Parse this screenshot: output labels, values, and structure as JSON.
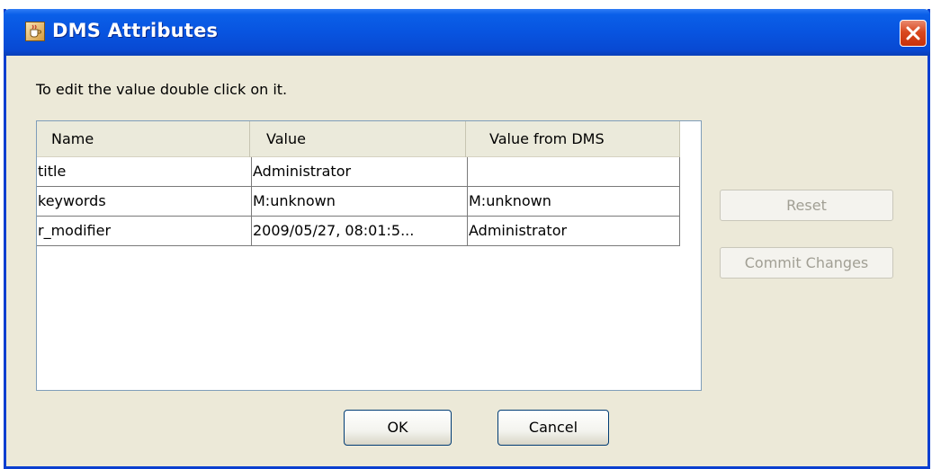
{
  "window": {
    "title": "DMS Attributes"
  },
  "instruction": "To edit the value double click on it.",
  "table": {
    "columns": [
      "Name",
      "Value",
      "Value from DMS"
    ],
    "rows": [
      {
        "name": "title",
        "value": "Administrator",
        "value_from_dms": ""
      },
      {
        "name": "keywords",
        "value": "M:unknown",
        "value_from_dms": "M:unknown"
      },
      {
        "name": "r_modifier",
        "value": "2009/05/27, 08:01:5...",
        "value_from_dms": "Administrator"
      }
    ]
  },
  "side_buttons": {
    "reset_label": "Reset",
    "commit_label": "Commit Changes"
  },
  "footer_buttons": {
    "ok_label": "OK",
    "cancel_label": "Cancel"
  },
  "icons": {
    "app_icon": "java-cup-icon",
    "close_icon": "close-icon"
  },
  "colors": {
    "titlebar": "#0854e0",
    "close_button": "#d9481f",
    "dialog_background": "#ece9d8",
    "disabled_text": "#a19f94"
  }
}
